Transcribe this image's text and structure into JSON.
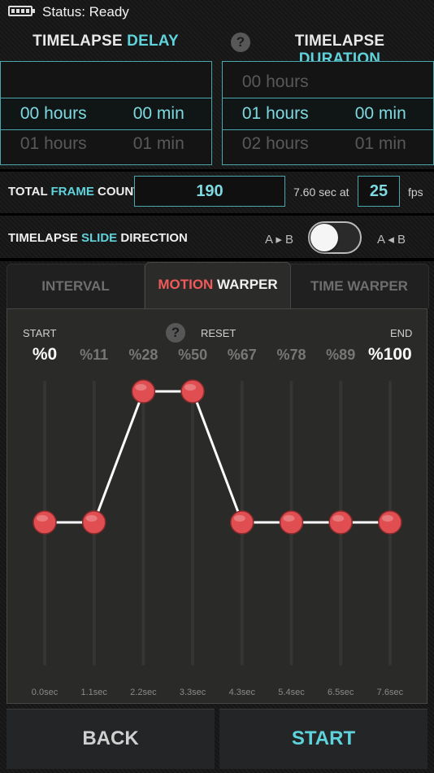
{
  "status": {
    "text": "Status: Ready"
  },
  "delay": {
    "title_a": "TIMELAPSE ",
    "title_b": "DELAY",
    "rows": [
      {
        "h": "",
        "m": ""
      },
      {
        "h": "00 hours",
        "m": "00 min"
      },
      {
        "h": "01 hours",
        "m": "01 min"
      }
    ]
  },
  "duration": {
    "title_a": "TIMELAPSE ",
    "title_b": "DURATION",
    "help": "?",
    "rows": [
      {
        "h": "00 hours",
        "m": ""
      },
      {
        "h": "01 hours",
        "m": "00 min"
      },
      {
        "h": "02 hours",
        "m": "01 min"
      }
    ]
  },
  "frame": {
    "label_a": "TOTAL ",
    "label_b": "FRAME",
    "label_c": " COUNT",
    "count": "190",
    "sec_text": "7.60 sec at",
    "fps_value": "25",
    "fps_unit": "fps"
  },
  "direction": {
    "label_a": "TIMELAPSE ",
    "label_b": "SLIDE",
    "label_c": " DIRECTION",
    "left_text": "A ▸ B",
    "right_text": "A ◂ B",
    "toggle_on": false
  },
  "tabs": {
    "interval": "INTERVAL",
    "motion_a": "MOTION",
    "motion_b": " WARPER",
    "time": "TIME WARPER"
  },
  "graph": {
    "start_label": "START",
    "reset_label": "RESET",
    "end_label": "END",
    "help": "?",
    "percent_labels": [
      "%0",
      "%11",
      "%28",
      "%50",
      "%67",
      "%78",
      "%89",
      "%100"
    ],
    "time_labels": [
      "0.0sec",
      "1.1sec",
      "2.2sec",
      "3.3sec",
      "4.3sec",
      "5.4sec",
      "6.5sec",
      "7.6sec"
    ],
    "point_levels": [
      0.5,
      0.5,
      1.0,
      1.0,
      0.5,
      0.5,
      0.5,
      0.5
    ],
    "node_color": "#e04e52",
    "line_color": "#ffffff"
  },
  "buttons": {
    "back": "BACK",
    "start": "START",
    "back_color": "#d0d0d0",
    "start_color": "#5fd3dc"
  }
}
